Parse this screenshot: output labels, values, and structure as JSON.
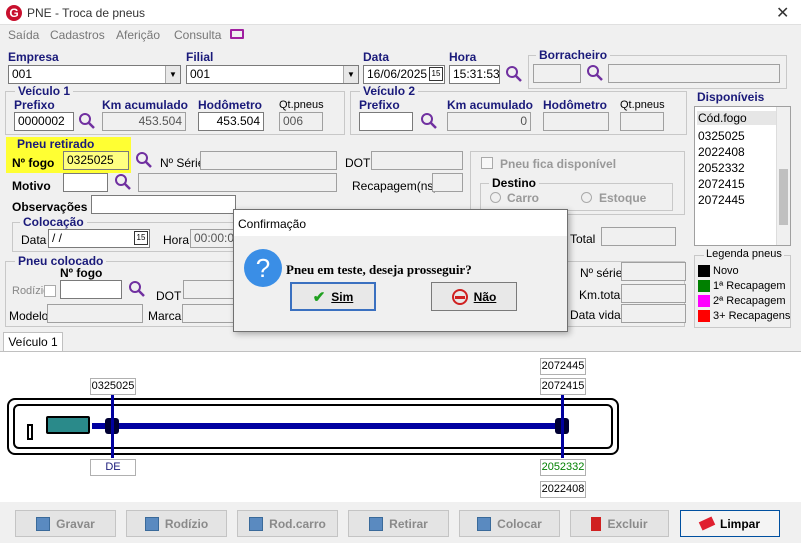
{
  "window": {
    "title": "PNE - Troca de pneus"
  },
  "menu": [
    "Saída",
    "Cadastros",
    "Aferição",
    "Consulta"
  ],
  "header": {
    "empresa_label": "Empresa",
    "empresa_value": "001",
    "filial_label": "Filial",
    "filial_value": "001",
    "data_label": "Data",
    "data_value": "16/06/2025",
    "hora_label": "Hora",
    "hora_value": "15:31:53",
    "borracheiro_label": "Borracheiro"
  },
  "veiculo1": {
    "title": "Veículo 1",
    "prefixo_label": "Prefixo",
    "prefixo_value": "0000002",
    "km_label": "Km acumulado",
    "km_value": "453.504",
    "hodometro_label": "Hodômetro",
    "hodometro_value": "453.504",
    "qtpneus_label": "Qt.pneus",
    "qtpneus_value": "006"
  },
  "veiculo2": {
    "title": "Veículo 2",
    "prefixo_label": "Prefixo",
    "prefixo_value": "",
    "km_label": "Km acumulado",
    "km_value": "0",
    "hodometro_label": "Hodômetro",
    "qtpneus_label": "Qt.pneus"
  },
  "disponiveis": {
    "title": "Disponíveis",
    "header": "Cód.fogo",
    "items": [
      "0325025",
      "2022408",
      "2052332",
      "2072415",
      "2072445"
    ]
  },
  "pneu_retirado": {
    "title": "Pneu retirado",
    "nfogo_label": "Nº fogo",
    "nfogo_value": "0325025",
    "nserie_label": "Nº Série",
    "dot_label": "DOT",
    "motivo_label": "Motivo",
    "recapagem_label": "Recapagem(ns)",
    "observacoes_label": "Observações",
    "colocacao_title": "Colocação",
    "data_label": "Data",
    "data_value": " /  /",
    "hora_label": "Hora",
    "hora_value": "00:00:00",
    "total_label": "Total"
  },
  "disponivel_opts": {
    "checkbox_label": "Pneu fica disponível",
    "destino_title": "Destino",
    "carro_label": "Carro",
    "estoque_label": "Estoque"
  },
  "pneu_colocado": {
    "title": "Pneu colocado",
    "nfogo_label": "Nº fogo",
    "rodizio_label": "Rodízio",
    "dot_label": "DOT",
    "modelo_label": "Modelo",
    "marca_label": "Marca",
    "nserie_label": "Nº série",
    "kmtotal_label": "Km.total",
    "datavida_label": "Data vida"
  },
  "legenda": {
    "title": "Legenda pneus",
    "items": [
      {
        "label": "Novo",
        "color": "#000000"
      },
      {
        "label": "1ª Recapagem",
        "color": "#008000"
      },
      {
        "label": "2ª Recapagem",
        "color": "#ff00ff"
      },
      {
        "label": "3+ Recapagens",
        "color": "#ff0000"
      }
    ]
  },
  "tab": {
    "label": "Veículo 1"
  },
  "diagram": {
    "tire_top_left": "0325025",
    "tire_bottom_left": "DE",
    "tire_top_right_outer": "2072445",
    "tire_top_right_inner": "2072415",
    "tire_bottom_right_inner": "2052332",
    "tire_bottom_right_outer": "2022408"
  },
  "dialog": {
    "title": "Confirmação",
    "message": "Pneu em teste, deseja prosseguir?",
    "yes_label": "Sim",
    "no_label": "Não"
  },
  "toolbar": {
    "gravar": "Gravar",
    "rodizio": "Rodízio",
    "rodcarro": "Rod.carro",
    "retirar": "Retirar",
    "colocar": "Colocar",
    "excluir": "Excluir",
    "limpar": "Limpar"
  }
}
